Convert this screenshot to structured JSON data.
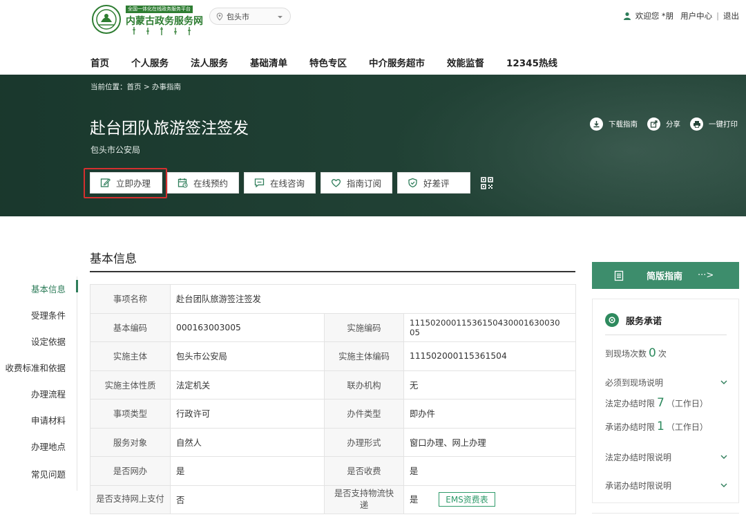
{
  "header": {
    "logo_tag": "全国一体化在线政务服务平台",
    "logo_name": "内蒙古政务服务网",
    "city": "包头市",
    "welcome": "欢迎您 *朋",
    "user_center": "用户中心",
    "separator": "|",
    "logout": "退出"
  },
  "nav": [
    "首页",
    "个人服务",
    "法人服务",
    "基础清单",
    "特色专区",
    "中介服务超市",
    "效能监督",
    "12345热线"
  ],
  "hero": {
    "breadcrumb": "当前位置：首页 > 办事指南",
    "title": "赴台团队旅游签注签发",
    "department": "包头市公安局",
    "tools": {
      "download": "下载指南",
      "share": "分享",
      "print": "一键打印"
    },
    "actions": {
      "apply": "立即办理",
      "reserve": "在线预约",
      "consult": "在线咨询",
      "subscribe": "指南订阅",
      "rate": "好差评"
    }
  },
  "section_title": "基本信息",
  "sidenav": [
    "基本信息",
    "受理条件",
    "设定依据",
    "收费标准和依据",
    "办理流程",
    "申请材料",
    "办理地点",
    "常见问题"
  ],
  "table": {
    "r1": {
      "l1": "事项名称",
      "v1": "赴台团队旅游签注签发"
    },
    "r2": {
      "l1": "基本编码",
      "v1": "000163003005",
      "l2": "实施编码",
      "v2": "11150200011536150430001630030​05"
    },
    "r3": {
      "l1": "实施主体",
      "v1": "包头市公安局",
      "l2": "实施主体编码",
      "v2": "111502000115361504"
    },
    "r4": {
      "l1": "实施主体性质",
      "v1": "法定机关",
      "l2": "联办机构",
      "v2": "无"
    },
    "r5": {
      "l1": "事项类型",
      "v1": "行政许可",
      "l2": "办件类型",
      "v2": "即办件"
    },
    "r6": {
      "l1": "服务对象",
      "v1": "自然人",
      "l2": "办理形式",
      "v2": "窗口办理、网上办理"
    },
    "r7": {
      "l1": "是否网办",
      "v1": "是",
      "l2": "是否收费",
      "v2": "是"
    },
    "r8": {
      "l1": "是否支持网上支付",
      "v1": "否",
      "l2": "是否支持物流快递",
      "v2": "是",
      "ems": "EMS资费表"
    }
  },
  "right": {
    "simple_guide": "简版指南",
    "simple_arrow": "···>",
    "promise_title": "服务承诺",
    "visits_label": "到现场次数",
    "visits_num": "0",
    "visits_unit": "次",
    "must_visit": "必须到现场说明",
    "legal_label": "法定办结时限",
    "legal_num": "7",
    "legal_unit": "（工作日）",
    "promise_label": "承诺办结时限",
    "promise_num": "1",
    "promise_unit": "（工作日）",
    "legal_desc": "法定办结时限说明",
    "promise_desc": "承诺办结时限说明"
  },
  "colors": {
    "brand_green": "#2e7d5a",
    "hero_bg": "#244538",
    "highlight": "#d62f2f"
  }
}
